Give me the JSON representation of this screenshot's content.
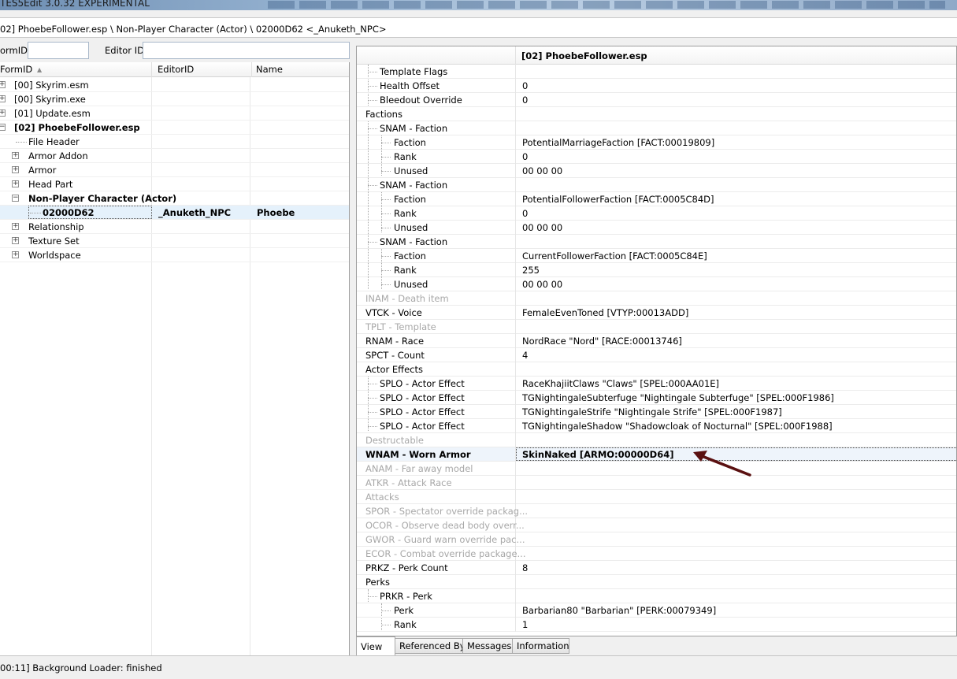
{
  "window": {
    "title": "TES5Edit 3.0.32 EXPERIMENTAL"
  },
  "path": {
    "text": "02] PhoebeFollower.esp \\ Non-Player Character (Actor) \\ 02000D62 <_Anuketh_NPC>"
  },
  "filter": {
    "formid_label": "ormID",
    "formid_value": "",
    "editorid_label": "Editor ID",
    "editorid_value": ""
  },
  "tree": {
    "columns": [
      "FormID",
      "EditorID",
      "Name"
    ],
    "rows": [
      {
        "label": "[00] Skyrim.esm"
      },
      {
        "label": "[00] Skyrim.exe"
      },
      {
        "label": "[01] Update.esm"
      },
      {
        "label": "[02] PhoebeFollower.esp"
      },
      {
        "label": "File Header"
      },
      {
        "label": "Armor Addon"
      },
      {
        "label": "Armor"
      },
      {
        "label": "Head Part"
      },
      {
        "label": "Non-Player Character (Actor)"
      },
      {
        "label": "02000D62",
        "editorid": "_Anuketh_NPC",
        "name": "Phoebe"
      },
      {
        "label": "Relationship"
      },
      {
        "label": "Texture Set"
      },
      {
        "label": "Worldspace"
      }
    ]
  },
  "record": {
    "header": "[02] PhoebeFollower.esp",
    "rows": [
      {
        "key": "Template Flags",
        "value": ""
      },
      {
        "key": "Health Offset",
        "value": "0"
      },
      {
        "key": "Bleedout Override",
        "value": "0"
      },
      {
        "key": "Factions",
        "value": ""
      },
      {
        "key": "SNAM - Faction",
        "value": ""
      },
      {
        "key": "Faction",
        "value": "PotentialMarriageFaction [FACT:00019809]"
      },
      {
        "key": "Rank",
        "value": "0"
      },
      {
        "key": "Unused",
        "value": "00 00 00"
      },
      {
        "key": "SNAM - Faction",
        "value": ""
      },
      {
        "key": "Faction",
        "value": "PotentialFollowerFaction [FACT:0005C84D]"
      },
      {
        "key": "Rank",
        "value": "0"
      },
      {
        "key": "Unused",
        "value": "00 00 00"
      },
      {
        "key": "SNAM - Faction",
        "value": ""
      },
      {
        "key": "Faction",
        "value": "CurrentFollowerFaction [FACT:0005C84E]"
      },
      {
        "key": "Rank",
        "value": "255"
      },
      {
        "key": "Unused",
        "value": "00 00 00"
      },
      {
        "key": "INAM - Death item",
        "value": ""
      },
      {
        "key": "VTCK - Voice",
        "value": "FemaleEvenToned [VTYP:00013ADD]"
      },
      {
        "key": "TPLT - Template",
        "value": ""
      },
      {
        "key": "RNAM - Race",
        "value": "NordRace \"Nord\" [RACE:00013746]"
      },
      {
        "key": "SPCT - Count",
        "value": "4"
      },
      {
        "key": "Actor Effects",
        "value": ""
      },
      {
        "key": "SPLO - Actor Effect",
        "value": "RaceKhajiitClaws \"Claws\" [SPEL:000AA01E]"
      },
      {
        "key": "SPLO - Actor Effect",
        "value": "TGNightingaleSubterfuge \"Nightingale Subterfuge\" [SPEL:000F1986]"
      },
      {
        "key": "SPLO - Actor Effect",
        "value": "TGNightingaleStrife \"Nightingale Strife\" [SPEL:000F1987]"
      },
      {
        "key": "SPLO - Actor Effect",
        "value": "TGNightingaleShadow \"Shadowcloak of Nocturnal\" [SPEL:000F1988]"
      },
      {
        "key": "Destructable",
        "value": ""
      },
      {
        "key": "WNAM - Worn Armor",
        "value": "SkinNaked [ARMO:00000D64]"
      },
      {
        "key": "ANAM - Far away model",
        "value": ""
      },
      {
        "key": "ATKR - Attack Race",
        "value": ""
      },
      {
        "key": "Attacks",
        "value": ""
      },
      {
        "key": "SPOR - Spectator override packag...",
        "value": ""
      },
      {
        "key": "OCOR - Observe dead body overr...",
        "value": ""
      },
      {
        "key": "GWOR - Guard warn override pac...",
        "value": ""
      },
      {
        "key": "ECOR - Combat override package...",
        "value": ""
      },
      {
        "key": "PRKZ - Perk Count",
        "value": "8"
      },
      {
        "key": "Perks",
        "value": ""
      },
      {
        "key": "PRKR - Perk",
        "value": ""
      },
      {
        "key": "Perk",
        "value": "Barbarian80 \"Barbarian\" [PERK:00079349]"
      },
      {
        "key": "Rank",
        "value": "1"
      }
    ]
  },
  "tabs": [
    "View",
    "Referenced By",
    "Messages",
    "Information"
  ],
  "status": {
    "text": "00:11] Background Loader: finished"
  },
  "colors": {
    "selection": "#e5f1fb",
    "annotation_arrow": "#5a1010",
    "disabled_text": "#a8a8a8"
  }
}
